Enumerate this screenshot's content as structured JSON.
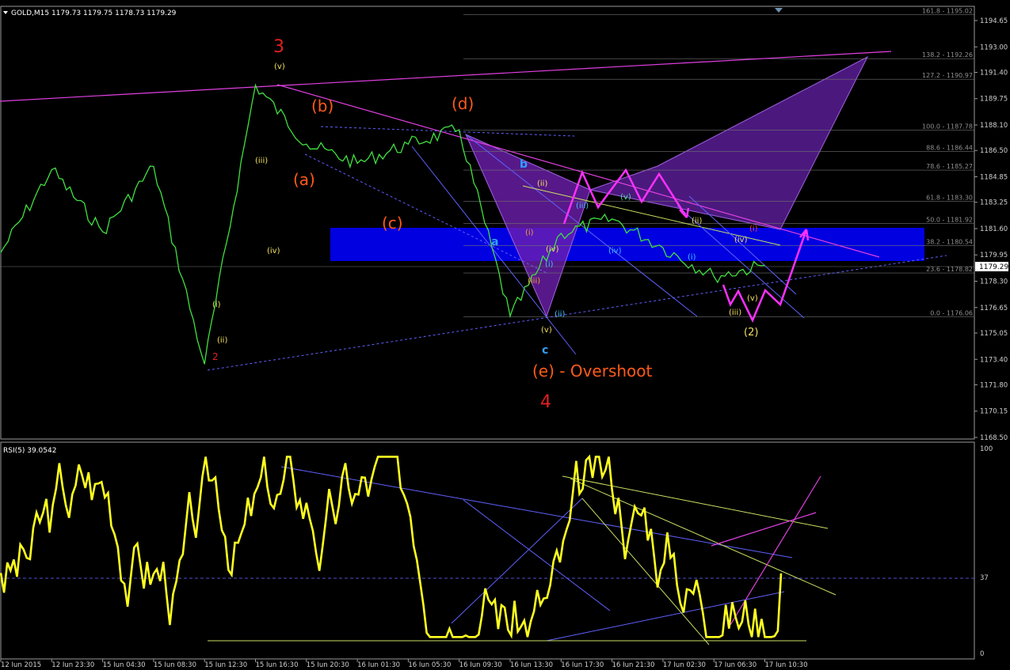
{
  "header": {
    "symbol_info": "GOLD,M15  1179.73 1179.75 1178.73 1179.29"
  },
  "rsi_header": "RSI(5) 39.0542",
  "price_axis_labels": [
    "1194.65",
    "1193.00",
    "1191.40",
    "1189.75",
    "1188.10",
    "1186.50",
    "1184.85",
    "1183.25",
    "1181.60",
    "1179.95",
    "1178.30",
    "1176.65",
    "1175.05",
    "1173.40",
    "1171.80",
    "1170.15",
    "1168.50"
  ],
  "current_price_label": "1179.29",
  "rsi_axis_labels": [
    "100",
    "37",
    "0"
  ],
  "time_axis_labels": [
    "12 Jun 2015",
    "12 Jun 23:30",
    "15 Jun 04:30",
    "15 Jun 08:30",
    "15 Jun 12:30",
    "15 Jun 16:30",
    "15 Jun 20:30",
    "16 Jun 01:30",
    "16 Jun 05:30",
    "16 Jun 09:30",
    "16 Jun 13:30",
    "16 Jun 17:30",
    "16 Jun 21:30",
    "17 Jun 02:30",
    "17 Jun 06:30",
    "17 Jun 10:30"
  ],
  "fib_levels": [
    {
      "label": "161.8 - 1195.02"
    },
    {
      "label": "138.2 - 1192.26"
    },
    {
      "label": "127.2 - 1190.97"
    },
    {
      "label": "100.0 - 1187.78"
    },
    {
      "label": "88.6 - 1186.44"
    },
    {
      "label": "78.6 - 1185.27"
    },
    {
      "label": "61.8 - 1183.30"
    },
    {
      "label": "50.0 - 1181.92"
    },
    {
      "label": "38.2 - 1180.54"
    },
    {
      "label": "23.6 - 1178.82"
    },
    {
      "label": "0.0 - 1176.06"
    }
  ],
  "wave_labels": {
    "big_3": "3",
    "big_4": "4",
    "big_2": "2",
    "a_paren": "(a)",
    "b_paren": "(b)",
    "c_paren": "(c)",
    "d_paren": "(d)",
    "e_overshoot": "(e) - Overshoot",
    "a_cyan": "a",
    "b_cyan": "b",
    "c_cyan": "c",
    "wave_2_paren": "(2)",
    "small_v": "(v)",
    "small_i": "(i)",
    "small_ii": "(ii)",
    "small_iii": "(iii)",
    "small_iv": "(iv)"
  },
  "chart_data": {
    "type": "line",
    "instrument": "GOLD",
    "timeframe": "M15",
    "ylim": [
      1168.5,
      1195.5
    ],
    "close_path": [
      {
        "x": "12 Jun 2015",
        "y": 1180.1
      },
      {
        "x": "12 Jun 23:30",
        "y": 1185.3
      },
      {
        "x": "15 Jun 04:30",
        "y": 1181.4
      },
      {
        "x": "15 Jun 08:30",
        "y": 1185.5
      },
      {
        "x": "15 Jun 12:30",
        "y": 1173.1
      },
      {
        "x": "15 Jun 16:30",
        "y": 1190.6
      },
      {
        "x": "15 Jun 20:30",
        "y": 1186.9
      },
      {
        "x": "16 Jun 01:30",
        "y": 1185.7
      },
      {
        "x": "16 Jun 05:30",
        "y": 1186.9
      },
      {
        "x": "16 Jun 09:30",
        "y": 1187.8
      },
      {
        "x": "16 Jun 13:30",
        "y": 1176.1
      },
      {
        "x": "16 Jun 17:30",
        "y": 1181.3
      },
      {
        "x": "16 Jun 21:30",
        "y": 1182.2
      },
      {
        "x": "17 Jun 02:30",
        "y": 1180.4
      },
      {
        "x": "17 Jun 06:30",
        "y": 1178.6
      },
      {
        "x": "17 Jun 10:30",
        "y": 1179.29
      }
    ],
    "rsi": {
      "name": "RSI(5)",
      "last": 39.0542,
      "level": 37,
      "ylim": [
        0,
        100
      ]
    }
  }
}
